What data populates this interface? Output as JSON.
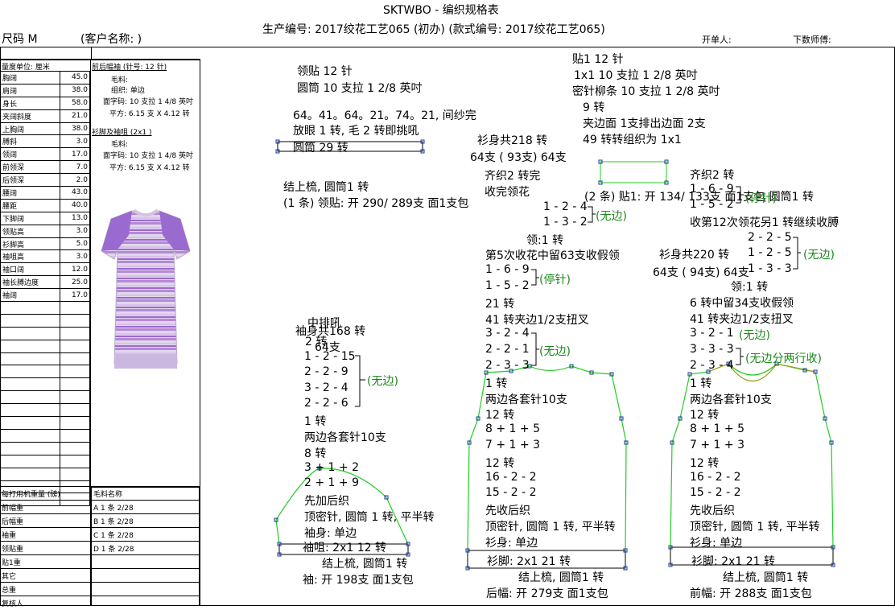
{
  "header": {
    "title": "SKTWBO - 编织规格表",
    "subtitle": "生产编号: 2017绞花工艺065 (初办)  (款式编号: 2017绞花工艺065)",
    "size_label": "尺码  M",
    "customer_label": "(客户名称:                     )",
    "order_person": "开单人:",
    "knitter": "下数师傅:"
  },
  "spec": {
    "unit_label": "量度单位: 厘米",
    "rows": [
      {
        "name": "胸阔",
        "value": "45.0"
      },
      {
        "name": "肩阔",
        "value": "38.0"
      },
      {
        "name": "身长",
        "value": "58.0"
      },
      {
        "name": "夹阔斜度",
        "value": "21.0"
      },
      {
        "name": "上胸阔",
        "value": "38.0"
      },
      {
        "name": "膊斜",
        "value": "3.0"
      },
      {
        "name": "领阔",
        "value": "17.0"
      },
      {
        "name": "前领深",
        "value": "7.0"
      },
      {
        "name": "后领深",
        "value": "2.0"
      },
      {
        "name": "腰阔",
        "value": "43.0"
      },
      {
        "name": "腰距",
        "value": "40.0"
      },
      {
        "name": "下脚阔",
        "value": "13.0"
      },
      {
        "name": "领贴高",
        "value": "3.0"
      },
      {
        "name": "衫脚高",
        "value": "5.0"
      },
      {
        "name": "袖咀高",
        "value": "3.0"
      },
      {
        "name": "袖口阔",
        "value": "12.0"
      },
      {
        "name": "袖长膊边度",
        "value": "25.0"
      },
      {
        "name": "袖阔",
        "value": "17.0"
      },
      {
        "name": "",
        "value": ""
      },
      {
        "name": "",
        "value": ""
      },
      {
        "name": "",
        "value": ""
      },
      {
        "name": "",
        "value": ""
      },
      {
        "name": "",
        "value": ""
      },
      {
        "name": "",
        "value": ""
      },
      {
        "name": "",
        "value": ""
      },
      {
        "name": "",
        "value": ""
      },
      {
        "name": "",
        "value": ""
      },
      {
        "name": "",
        "value": ""
      },
      {
        "name": "",
        "value": ""
      },
      {
        "name": "",
        "value": ""
      },
      {
        "name": "",
        "value": ""
      },
      {
        "name": "",
        "value": ""
      },
      {
        "name": "",
        "value": ""
      },
      {
        "name": "",
        "value": ""
      }
    ]
  },
  "body_info": {
    "title": "前后幅袖 (针号: 12 针)",
    "yarn": "毛料:",
    "structure": "组织: 单边",
    "density1": "面字码: 10 支拉 1 4/8 英吋",
    "density2": "平方: 6.15 支 X 4.12 转",
    "rib_title": "衫脚及袖咀 (2x1 )",
    "rib_yarn": "毛料:",
    "rib_density1": "面字码: 10 支拉 1 4/8 英吋",
    "rib_density2": "平方: 6.15 支 X 4.12 转"
  },
  "weights": {
    "header_left": "每打用机重量 (磅)",
    "header_right": "毛料名称",
    "rows": [
      {
        "name": "前幅重",
        "yarn": "A  1 条 2/28"
      },
      {
        "name": "后幅重",
        "yarn": "B  1 条 2/28"
      },
      {
        "name": "袖重",
        "yarn": "C  1 条 2/28"
      },
      {
        "name": "领贴重",
        "yarn": "D  1 条 2/28"
      },
      {
        "name": "贴1重",
        "yarn": ""
      },
      {
        "name": "其它",
        "yarn": ""
      },
      {
        "name": "总重",
        "yarn": ""
      },
      {
        "name": "复核人",
        "yarn": ""
      }
    ]
  },
  "collar": {
    "l1": "领贴  12 针",
    "l2": "圆筒 10 支拉 1 2/8 英吋",
    "l3": "64。41。64。21。74。21, 间纱完",
    "l4": "放眼 1 转, 毛 2 转即挑吼",
    "l5": "圆筒    29 转",
    "l6": "结上梳, 圆筒1 转",
    "l7": "(1 条) 领贴: 开 290/ 289支 面1支包"
  },
  "patch": {
    "l1": "贴1  12 针",
    "l2": "1x1   10 支拉 1 2/8 英吋",
    "l3": "密针柳条 10 支拉 1 2/8 英吋",
    "l4": "9 转",
    "l5": "夹边面 1支排出边面 2支",
    "l6": "49 转转组织为  1x1",
    "l7": "(2 条) 贴1: 开 134/ 133支 面1支包 圆筒1 转"
  },
  "sleeve": {
    "a1": "袖身共168 转",
    "a2": "中排吼",
    "a3": "2 转",
    "a4": "64支",
    "d1": "1 - 2 - 15",
    "d2": "2 - 2 - 9",
    "d3": "3 - 2 - 4",
    "d4": "2 - 2 - 6",
    "tag": "(无边)",
    "b1": "1 转",
    "b2": "两边各套针10支",
    "b3": "8 转",
    "b4": "3 + 1 + 2",
    "b5": "2 + 1 + 9",
    "b6": "先加后织",
    "b7": "顶密针, 圆筒 1 转, 平半转",
    "b8": "袖身: 单边",
    "b9": "袖咀: 2x1     12 转",
    "b10": "结上梳, 圆筒1 转",
    "b11": "袖: 开 198支 面1支包"
  },
  "back": {
    "a1": "衫身共218 转",
    "a2": "64支 ( 93支) 64支",
    "a3": "齐织2 转完",
    "a4": "收完领花",
    "n1": "1 - 2 - 4",
    "n2": "1 - 3 - 2",
    "ntag": "(无边)",
    "a5": "领:1 转",
    "a6": "第5次收花中留63支收假领",
    "s1": "1 - 6 - 9",
    "s2": "1 - 5 - 2",
    "stag": "(停针)",
    "a7": "21 转",
    "a8": "41 转夹边1/2支扭叉",
    "r1": "3 - 2 - 4",
    "r2": "2 - 2 - 1",
    "r3": "2 - 3 - 3",
    "rtag": "(无边)",
    "b1": "1 转",
    "b2": "两边各套针10支",
    "b3": "12 转",
    "b4": "8 + 1 + 5",
    "b5": "7 + 1 + 3",
    "b6": "12 转",
    "b7": "16 - 2 - 2",
    "b8": "15 - 2 - 2",
    "b9": "先收后织",
    "b10": "顶密针, 圆筒 1 转, 平半转",
    "b11": "衫身: 单边",
    "b12": "衫脚: 2x1     21 转",
    "b13": "结上梳, 圆筒1 转",
    "b14": "后幅: 开 279支 面1支包"
  },
  "front": {
    "a1": "齐织2 转",
    "n1": "1 - 6 - 9",
    "n2": "1 - 5 - 2",
    "ntag": "(停针)",
    "a2": "收第12次领花另1 转继续收膊",
    "m1": "2 - 2 - 5",
    "m2": "1 - 2 - 5",
    "m3": "1 - 3 - 3",
    "mtag": "(无边)",
    "a3": "衫身共220 转",
    "a4": "64支 ( 94支) 64支",
    "a5": "领:1 转",
    "a6": "6 转中留34支收假领",
    "a7": "41 转夹边1/2支扭叉",
    "r1": "3 - 2 - 1",
    "r1tag": "(无边)",
    "r2": "3 - 3 - 3",
    "r3": "2 - 3 - 4",
    "rtag": "(无边分两行收)",
    "b1": "1 转",
    "b2": "两边各套针10支",
    "b3": "12 转",
    "b4": "8 + 1 + 5",
    "b5": "7 + 1 + 3",
    "b6": "12 转",
    "b7": "16 - 2 - 2",
    "b8": "15 - 2 - 2",
    "b9": "先收后织",
    "b10": "顶密针, 圆筒 1 转, 平半转",
    "b11": "衫身: 单边",
    "b12": "衫脚: 2x1     21 转",
    "b13": "结上梳, 圆筒1 转",
    "b14": "前幅: 开 288支 面1支包"
  },
  "colors": {
    "accent_green": "#1a8a1a",
    "outline_green": "#22cc22",
    "handle_blue": "#1a3aa0",
    "garment_purple": "#9a6ad0"
  }
}
